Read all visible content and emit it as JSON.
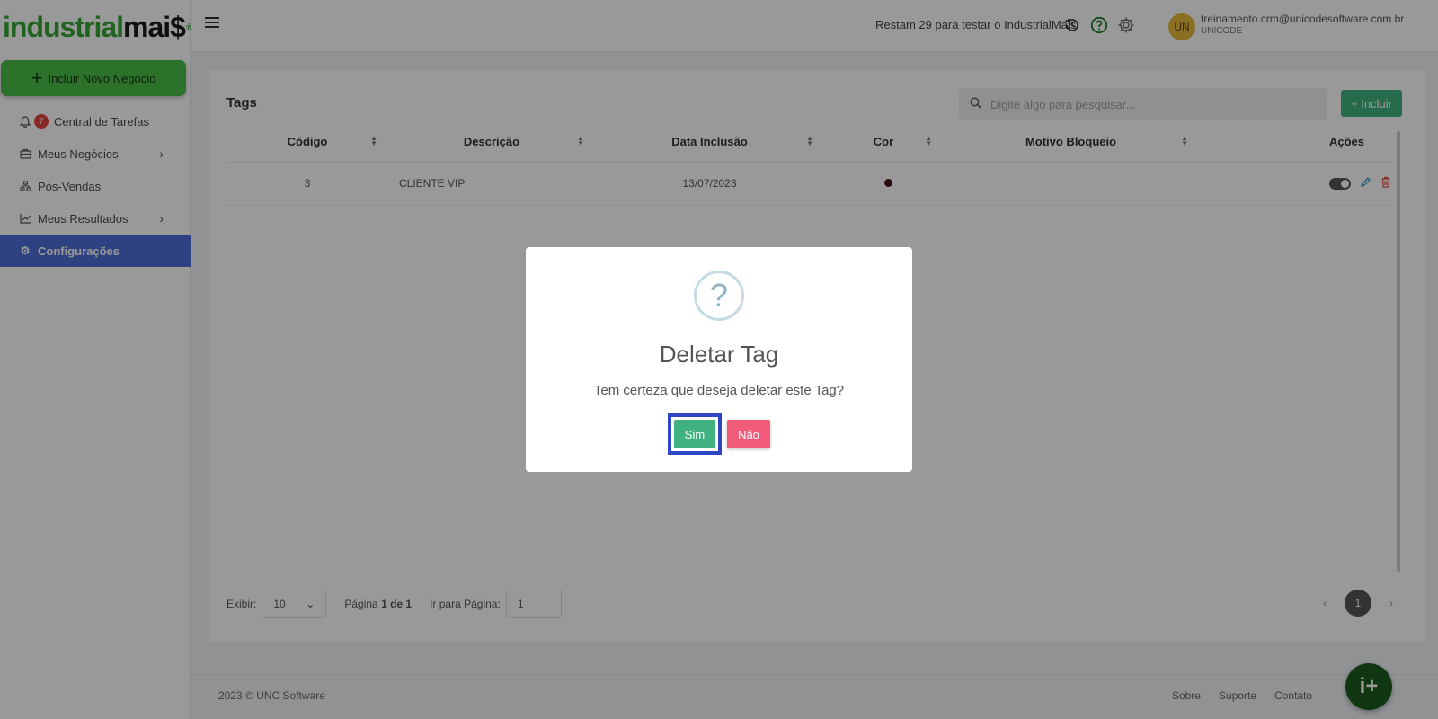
{
  "brand": {
    "part1": "industrial",
    "part2": "mai$",
    "reg": "®"
  },
  "sidebar": {
    "new_deal_label": "Incluir Novo Negócio",
    "items": [
      {
        "label": "Central de Tarefas",
        "badge": "7"
      },
      {
        "label": "Meus Negócios"
      },
      {
        "label": "Pós-Vendas"
      },
      {
        "label": "Meus Resultados"
      },
      {
        "label": "Configurações"
      }
    ]
  },
  "header": {
    "trial_text": "Restam 29 para testar o IndustrialMais",
    "avatar_initials": "UN",
    "user_email": "treinamento.crm@unicodesoftware.com.br",
    "user_org": "UNICODE"
  },
  "main": {
    "title": "Tags",
    "search_placeholder": "Digite algo para pesquisar...",
    "add_label": "+ Incluir",
    "columns": [
      "Código",
      "Descrição",
      "Data Inclusão",
      "Cor",
      "Motivo Bloqueio",
      "Ações"
    ],
    "rows": [
      {
        "codigo": "3",
        "descricao": "CLIENTE VIP",
        "data": "13/07/2023",
        "cor": "#4a1515",
        "motivo": "",
        "ativo": true
      }
    ],
    "pagination": {
      "show_label": "Exibir:",
      "per_page": "10",
      "page_label": "Página",
      "page_current": "1 de 1",
      "goto_label": "Ir para Página:",
      "goto_value": "1",
      "current_page": "1",
      "prev": "‹",
      "next": "›"
    }
  },
  "footer": {
    "copyright": "2023 © UNC Software",
    "links": [
      "Sobre",
      "Suporte",
      "Contato"
    ],
    "fab_label": "i+"
  },
  "modal": {
    "icon": "?",
    "title": "Deletar Tag",
    "text": "Tem certeza que deseja deletar este Tag?",
    "yes_label": "Sim",
    "no_label": "Não"
  },
  "colors": {
    "accent": "#4d6fd8",
    "success": "#3fb27f",
    "danger": "#ef5b79",
    "brand_green": "#35a532"
  }
}
